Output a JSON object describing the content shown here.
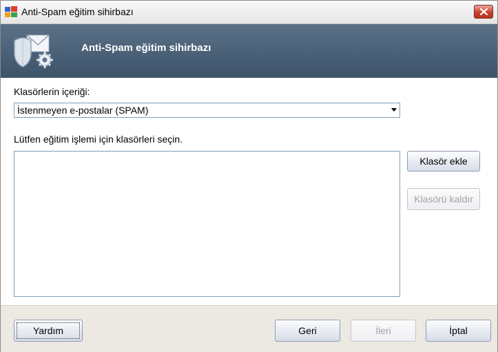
{
  "window": {
    "title": "Anti-Spam eğitim sihirbazı"
  },
  "banner": {
    "title": "Anti-Spam eğitim sihirbazı",
    "icon": "shield-mail-gear-icon"
  },
  "content": {
    "folder_contents_label": "Klasörlerin içeriği:",
    "folder_contents_select": {
      "selected": "İstenmeyen e-postalar (SPAM)"
    },
    "instruction_label": "Lütfen eğitim işlemi için klasörleri seçin.",
    "folder_list_items": [],
    "add_folder_label": "Klasör ekle",
    "remove_folder_label": "Klasörü kaldır"
  },
  "footer": {
    "help_label": "Yardım",
    "back_label": "Geri",
    "next_label": "İleri",
    "cancel_label": "İptal"
  },
  "colors": {
    "banner": "#4a6076",
    "close_button": "#c9402f",
    "dialog_bg": "#ece9e3"
  }
}
